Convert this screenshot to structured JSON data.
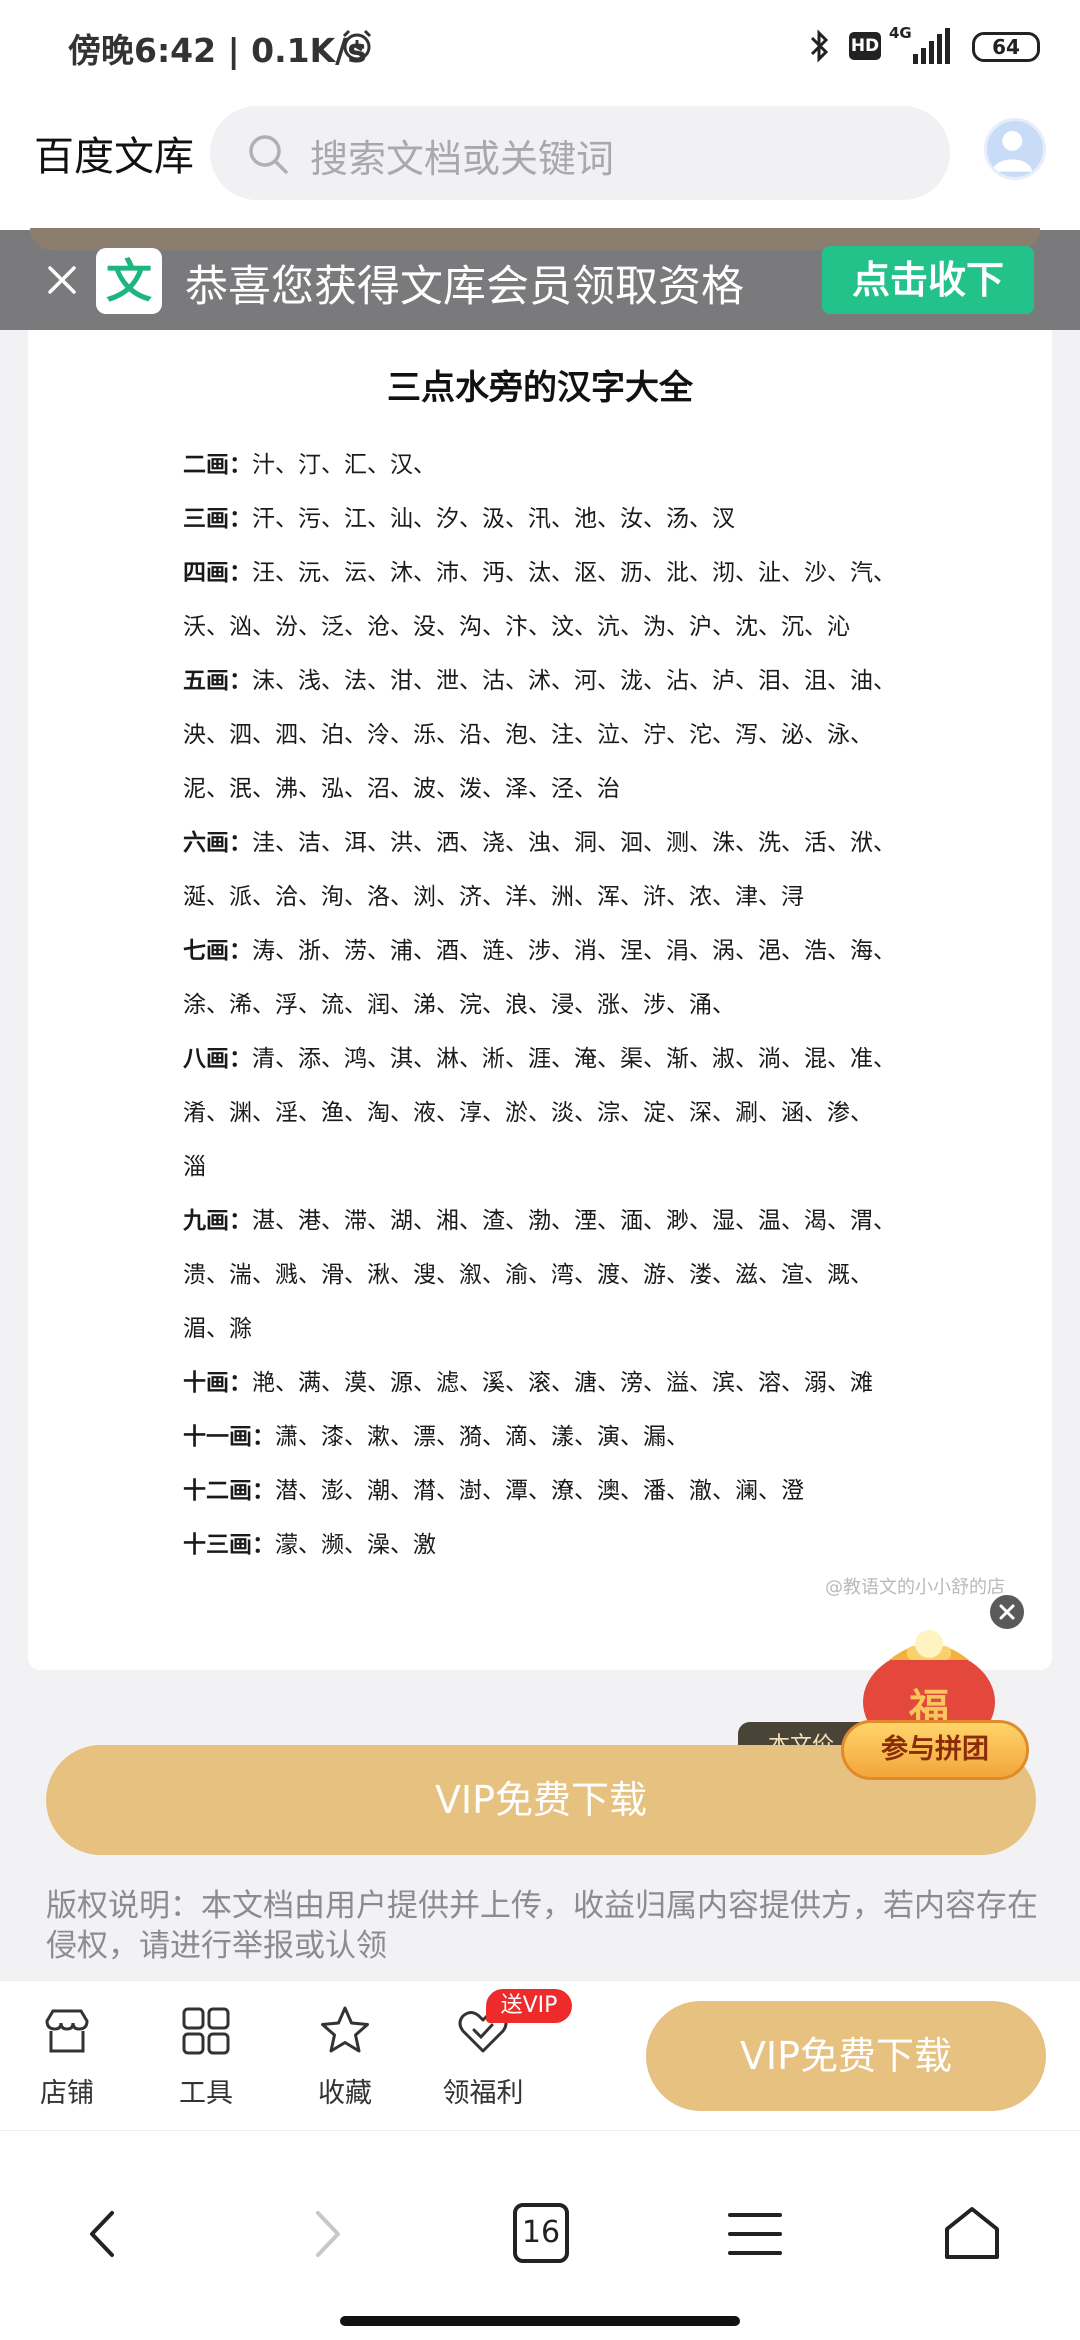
{
  "status": {
    "time": "傍晚6:42 | 0.1K/s",
    "network": "4G",
    "hd": "HD",
    "battery": "64"
  },
  "header": {
    "app_title": "百度文库",
    "search_placeholder": "搜索文档或关键词"
  },
  "banner": {
    "logo_char": "文",
    "text": "恭喜您获得文库会员领取资格",
    "button": "点击收下"
  },
  "document": {
    "title": "三点水旁的汉字大全",
    "lines": [
      {
        "label": "二画：",
        "text": "汁、汀、汇、汉、"
      },
      {
        "label": "三画：",
        "text": "汗、污、江、汕、汐、汲、汛、池、汝、汤、汊"
      },
      {
        "label": "四画：",
        "text": "汪、沅、沄、沐、沛、沔、汰、沤、沥、沘、沏、沚、沙、汽、"
      },
      {
        "label": "",
        "text": "沃、汹、汾、泛、沧、没、沟、汴、汶、沆、沩、沪、沈、沉、沁"
      },
      {
        "label": "五画：",
        "text": "沫、浅、法、泔、泄、沽、沭、河、泷、沾、泸、泪、沮、油、"
      },
      {
        "label": "",
        "text": "泱、泗、泗、泊、泠、泺、沿、泡、注、泣、泞、沱、泻、泌、泳、"
      },
      {
        "label": "",
        "text": "泥、泯、沸、泓、沼、波、泼、泽、泾、治"
      },
      {
        "label": "六画：",
        "text": "洼、洁、洱、洪、洒、浇、浊、洞、洄、测、洙、洗、活、洑、"
      },
      {
        "label": "",
        "text": "涎、派、洽、洵、洛、浏、济、洋、洲、浑、浒、浓、津、浔"
      },
      {
        "label": "七画：",
        "text": "涛、浙、涝、浦、酒、涟、涉、消、涅、涓、涡、浥、浩、海、"
      },
      {
        "label": "",
        "text": "涂、浠、浮、流、润、涕、浣、浪、浸、涨、涉、涌、"
      },
      {
        "label": "八画：",
        "text": "清、添、鸿、淇、淋、淅、涯、淹、渠、渐、淑、淌、混、准、"
      },
      {
        "label": "",
        "text": "淆、渊、淫、渔、淘、液、淳、淤、淡、淙、淀、深、涮、涵、渗、"
      },
      {
        "label": "",
        "text": "淄"
      },
      {
        "label": "九画：",
        "text": "湛、港、滞、湖、湘、渣、渤、湮、湎、渺、湿、温、渴、渭、"
      },
      {
        "label": "",
        "text": "溃、湍、溅、滑、湫、溲、溆、渝、湾、渡、游、溇、滋、渲、溉、"
      },
      {
        "label": "",
        "text": "湄、滁"
      },
      {
        "label": "十画：",
        "text": "滟、满、漠、源、滤、溪、滚、溏、滂、溢、滨、溶、溺、滩"
      },
      {
        "label": "十一画：",
        "text": "潇、漆、漱、漂、漪、滴、漾、演、漏、"
      },
      {
        "label": "十二画：",
        "text": "潜、澎、潮、潸、澍、潭、潦、澳、潘、澈、澜、澄"
      },
      {
        "label": "十三画：",
        "text": "濛、濒、澡、激"
      }
    ],
    "watermark": "@教语文的小小舒的店"
  },
  "lucky_bag": {
    "bag_char": "福",
    "button": "参与拼团"
  },
  "price_tag": "本文价",
  "vip_download": "VIP免费下载",
  "copyright": "版权说明：本文档由用户提供并上传，收益归属内容提供方，若内容存在侵权，请进行举报或认领",
  "actionbar": {
    "items": [
      {
        "label": "店铺",
        "icon": "store-icon"
      },
      {
        "label": "工具",
        "icon": "grid-icon"
      },
      {
        "label": "收藏",
        "icon": "star-icon"
      },
      {
        "label": "领福利",
        "icon": "gift-heart-icon"
      }
    ],
    "badge": "送VIP",
    "vip_button": "VIP免费下载"
  },
  "navbar": {
    "tab_count": "16"
  }
}
